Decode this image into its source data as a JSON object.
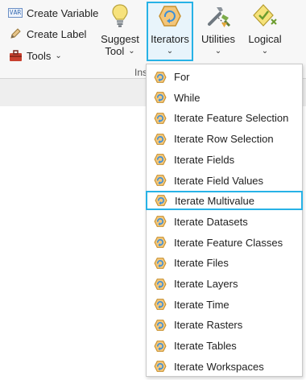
{
  "ribbon": {
    "create_variable": "Create Variable",
    "create_variable_icon_text": "VAR",
    "create_label": "Create Label",
    "tools": "Tools",
    "suggest_tool_line1": "Suggest",
    "suggest_tool_line2": "Tool",
    "iterators": "Iterators",
    "utilities": "Utilities",
    "logical": "Logical",
    "group_label": "Ins"
  },
  "iterators_menu": {
    "items": [
      {
        "label": "For",
        "icon": "iterator-icon"
      },
      {
        "label": "While",
        "icon": "iterator-icon"
      },
      {
        "label": "Iterate Feature Selection",
        "icon": "iterator-icon"
      },
      {
        "label": "Iterate Row Selection",
        "icon": "iterator-icon"
      },
      {
        "label": "Iterate Fields",
        "icon": "iterator-icon"
      },
      {
        "label": "Iterate Field Values",
        "icon": "iterator-icon"
      },
      {
        "label": "Iterate Multivalue",
        "icon": "iterator-icon",
        "highlighted": true
      },
      {
        "label": "Iterate Datasets",
        "icon": "iterator-icon"
      },
      {
        "label": "Iterate Feature Classes",
        "icon": "iterator-icon"
      },
      {
        "label": "Iterate Files",
        "icon": "iterator-icon"
      },
      {
        "label": "Iterate Layers",
        "icon": "iterator-icon"
      },
      {
        "label": "Iterate Time",
        "icon": "iterator-icon"
      },
      {
        "label": "Iterate Rasters",
        "icon": "iterator-icon"
      },
      {
        "label": "Iterate Tables",
        "icon": "iterator-icon"
      },
      {
        "label": "Iterate Workspaces",
        "icon": "iterator-icon"
      }
    ]
  },
  "colors": {
    "highlight_border": "#27b2e6",
    "iterator_fill": "#f3c67a",
    "iterator_stroke": "#c8912e",
    "iterator_arrow": "#3b8fd8"
  }
}
